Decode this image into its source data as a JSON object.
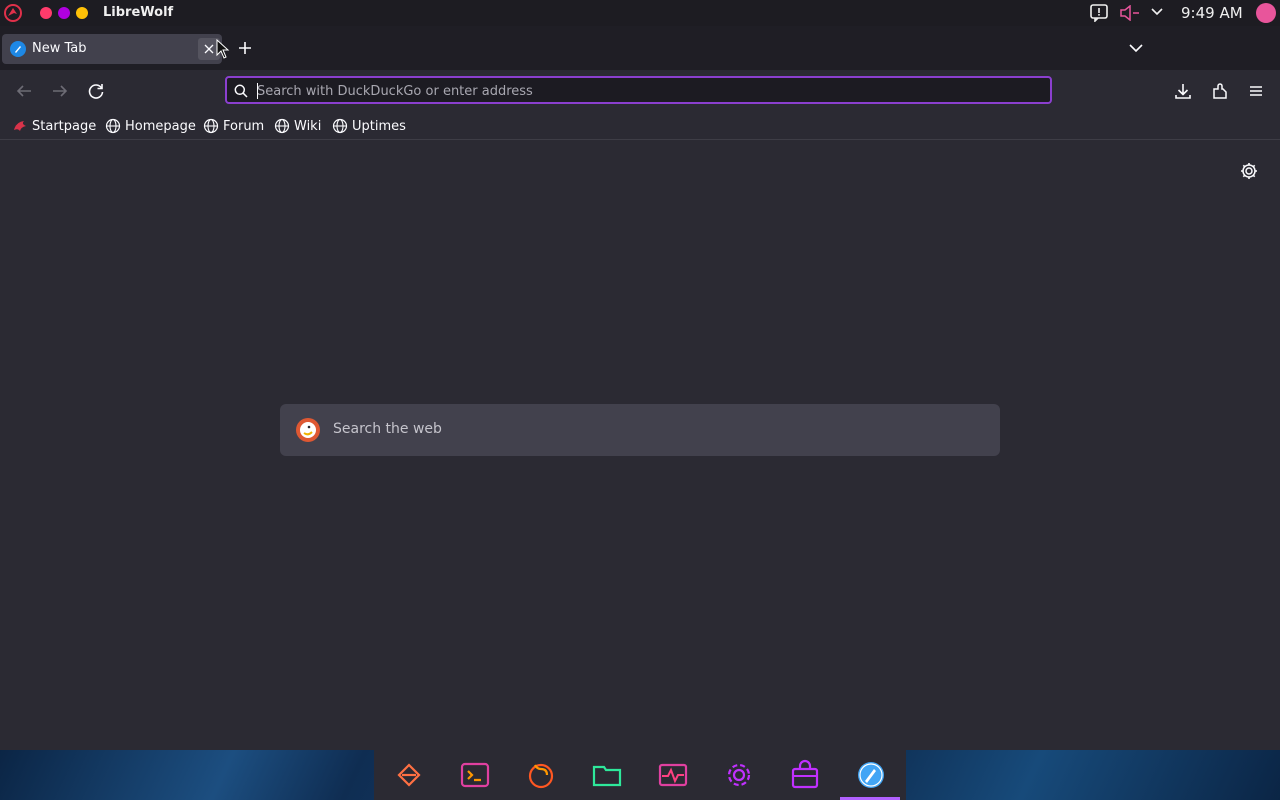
{
  "topbar": {
    "app_name": "LibreWolf",
    "clock": "9:49 AM",
    "icons": [
      "librewolf-logo-icon",
      "notification-icon",
      "volume-muted-icon",
      "chevron-down-icon",
      "user-avatar"
    ],
    "window_dot_colors": [
      "#ff3b6b",
      "#b000e0",
      "#ffc107"
    ]
  },
  "tabs": [
    {
      "title": "New Tab",
      "active": true
    }
  ],
  "navbar": {
    "url_placeholder": "Search with DuckDuckGo or enter address",
    "url_value": ""
  },
  "bookmarks": [
    {
      "label": "Startpage",
      "icon": "startpage-icon"
    },
    {
      "label": "Homepage",
      "icon": "globe-icon"
    },
    {
      "label": "Forum",
      "icon": "globe-icon"
    },
    {
      "label": "Wiki",
      "icon": "globe-icon"
    },
    {
      "label": "Uptimes",
      "icon": "globe-icon"
    }
  ],
  "content": {
    "search_placeholder": "Search the web"
  },
  "dock": {
    "items": [
      "app-launcher-icon",
      "terminal-icon",
      "firefox-icon",
      "files-icon",
      "system-monitor-icon",
      "settings-icon",
      "store-icon",
      "librewolf-icon"
    ],
    "active_index": 7
  },
  "colors": {
    "accent": "#8b3fcf",
    "background": "#2b2a33",
    "tab_active": "#42414d"
  }
}
